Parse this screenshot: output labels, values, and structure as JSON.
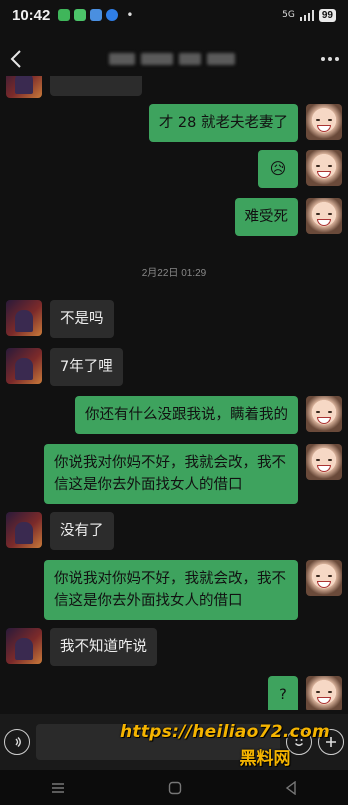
{
  "status_bar": {
    "time": "10:42",
    "signal": "5G",
    "battery": "99"
  },
  "header": {
    "back": "back-icon",
    "more": "more-icon"
  },
  "messages": [
    {
      "side": "left",
      "text": "",
      "type": "text-partial"
    },
    {
      "side": "right",
      "text": "才 28 就老夫老妻了"
    },
    {
      "side": "right",
      "text": "😥",
      "type": "emoji"
    },
    {
      "side": "right",
      "text": "难受死"
    },
    {
      "side": "left",
      "text": "不是吗"
    },
    {
      "side": "left",
      "text": "7年了哩"
    },
    {
      "side": "right",
      "text": "你还有什么没跟我说，瞒着我的"
    },
    {
      "side": "right",
      "text": "你说我对你妈不好，我就会改，我不信这是你去外面找女人的借口"
    },
    {
      "side": "left",
      "text": "没有了"
    },
    {
      "side": "right",
      "text": "你说我对你妈不好，我就会改，我不信这是你去外面找女人的借口"
    },
    {
      "side": "left",
      "text": "我不知道咋说"
    },
    {
      "side": "right",
      "text": "?"
    }
  ],
  "timestamp": "2月22日 01:29",
  "watermark": {
    "line1": "https://heiliao72.com",
    "line2": "黑料网"
  },
  "colors": {
    "bubble_self": "#3ea35e",
    "bubble_other": "#2c2c2c",
    "background": "#111111",
    "watermark": "#f5b400"
  }
}
